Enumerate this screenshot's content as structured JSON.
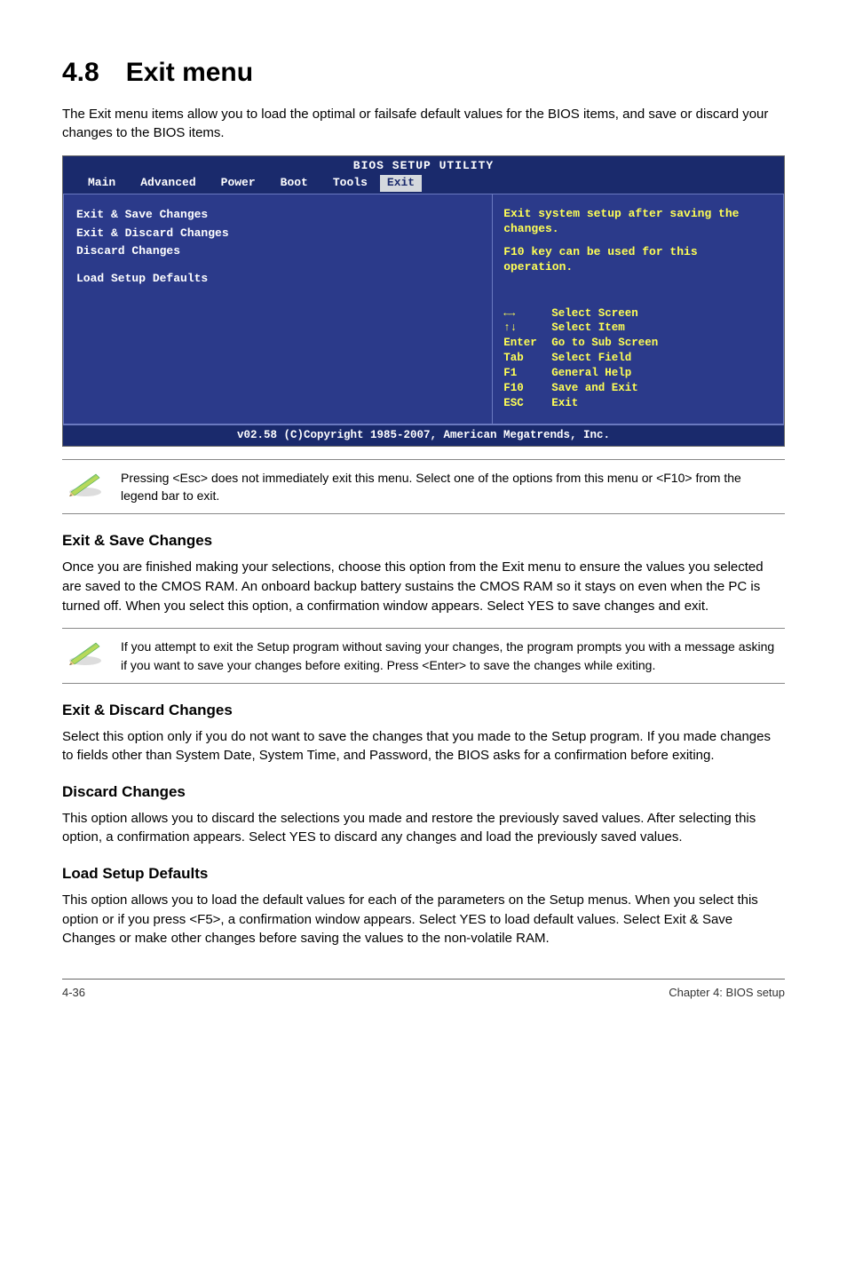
{
  "section": {
    "number": "4.8",
    "title": "Exit menu"
  },
  "intro": "The Exit menu items allow you to load the optimal or failsafe default values for the BIOS items, and save or discard your changes to the BIOS items.",
  "bios": {
    "title": "BIOS SETUP UTILITY",
    "tabs": {
      "main": "Main",
      "advanced": "Advanced",
      "power": "Power",
      "boot": "Boot",
      "tools": "Tools",
      "exit": "Exit"
    },
    "left_items": {
      "i0": "Exit & Save Changes",
      "i1": "Exit & Discard Changes",
      "i2": "Discard Changes",
      "i3": "Load Setup Defaults"
    },
    "help": {
      "l1": "Exit system setup after saving the changes.",
      "l2": "F10 key can be used for this operation."
    },
    "keys": {
      "k0": {
        "k": "←→",
        "d": "Select Screen"
      },
      "k1": {
        "k": "↑↓",
        "d": "Select Item"
      },
      "k2": {
        "k": "Enter",
        "d": "Go to Sub Screen"
      },
      "k3": {
        "k": "Tab",
        "d": "Select Field"
      },
      "k4": {
        "k": "F1",
        "d": "General Help"
      },
      "k5": {
        "k": "F10",
        "d": "Save and Exit"
      },
      "k6": {
        "k": "ESC",
        "d": "Exit"
      }
    },
    "footer": "v02.58 (C)Copyright 1985-2007, American Megatrends, Inc."
  },
  "note1": "Pressing <Esc> does not immediately exit this menu. Select one of the options from this menu or <F10> from the legend bar to exit.",
  "sub1": {
    "title": "Exit & Save Changes",
    "body": "Once you are finished making your selections, choose this option from the Exit menu to ensure the values you selected are saved to the CMOS RAM. An onboard backup battery sustains the CMOS RAM so it stays on even when the PC is turned off. When you select this option, a confirmation window appears. Select YES to save changes and exit."
  },
  "note2": " If you attempt to exit the Setup program without saving your changes, the program prompts you with a message asking if you want to save your changes before exiting. Press <Enter>  to save the  changes while exiting.",
  "sub2": {
    "title": "Exit & Discard Changes",
    "body": "Select this option only if you do not want to save the changes that you  made to the Setup program. If you made changes to fields other than System Date, System Time, and Password, the BIOS asks for a confirmation before exiting."
  },
  "sub3": {
    "title": "Discard Changes",
    "body": "This option allows you to discard the selections you made and restore the previously saved values. After selecting this option, a confirmation appears. Select YES to discard any changes and load the previously saved values."
  },
  "sub4": {
    "title": "Load Setup Defaults",
    "body": "This option allows you to load the default values for each of the parameters on the Setup menus. When you select this option or if you press <F5>, a confirmation window appears. Select YES to load default values. Select Exit & Save Changes or make other changes before saving the values to the non-volatile RAM."
  },
  "footer": {
    "left": "4-36",
    "right": "Chapter 4: BIOS setup"
  }
}
